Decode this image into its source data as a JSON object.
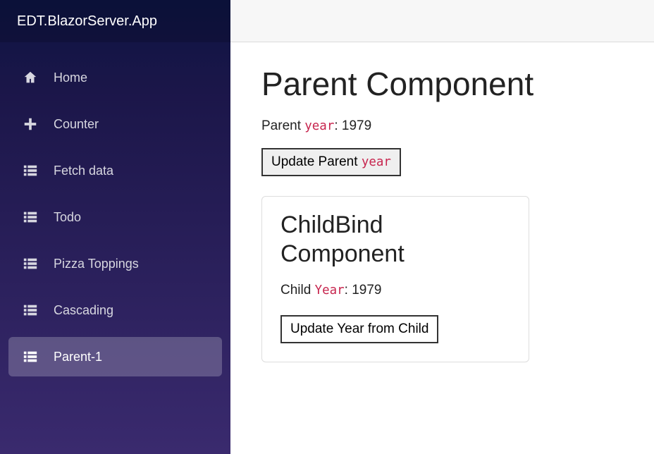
{
  "brand": "EDT.BlazorServer.App",
  "nav": {
    "items": [
      {
        "label": "Home",
        "icon": "home",
        "active": false
      },
      {
        "label": "Counter",
        "icon": "plus",
        "active": false
      },
      {
        "label": "Fetch data",
        "icon": "list",
        "active": false
      },
      {
        "label": "Todo",
        "icon": "list",
        "active": false
      },
      {
        "label": "Pizza Toppings",
        "icon": "list",
        "active": false
      },
      {
        "label": "Cascading",
        "icon": "list",
        "active": false
      },
      {
        "label": "Parent-1",
        "icon": "list",
        "active": true
      }
    ]
  },
  "main": {
    "heading": "Parent Component",
    "parent_line_prefix": "Parent ",
    "parent_code": "year",
    "parent_value_sep": ": ",
    "parent_value": "1979",
    "update_parent_btn_prefix": "Update Parent ",
    "update_parent_btn_code": "year",
    "child": {
      "heading": "ChildBind Component",
      "line_prefix": "Child ",
      "code": "Year",
      "value_sep": ": ",
      "value": "1979",
      "btn_label": "Update Year from Child"
    }
  }
}
